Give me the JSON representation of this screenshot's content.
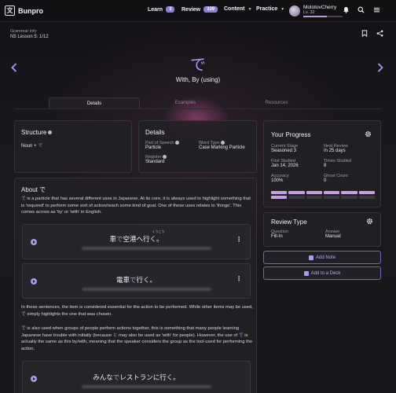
{
  "app": {
    "logo_glyph": "文",
    "name": "Bunpro"
  },
  "nav": {
    "learn_label": "Learn",
    "learn_count": "3",
    "review_label": "Review",
    "review_count": "339",
    "content_label": "Content",
    "practice_label": "Practice"
  },
  "user": {
    "name": "MolotovCherry",
    "level": "Lv. 32",
    "xp_fraction": 0.6
  },
  "header": {
    "section": "Grammar info",
    "lesson": "N5 Lesson 5: 1/12",
    "grammar": "で",
    "meaning": "With, By (using)"
  },
  "tabs": [
    "Details",
    "Examples",
    "Resources"
  ],
  "structure": {
    "title": "Structure",
    "formula_prefix": "Noun + ",
    "formula_particle": "で"
  },
  "details": {
    "title": "Details",
    "pos_label": "Part of Speech",
    "pos_value": "Particle",
    "word_type_label": "Word Type",
    "word_type_value": "Case Marking Particle",
    "register_label": "Register",
    "register_value": "Standard"
  },
  "about": {
    "title_prefix": "About ",
    "title_particle": "で",
    "p1_particle": "で",
    "p1": " is a particle that has several different uses in Japanese. At its core, it is always used to highlight something that is 'required' to perform some sort of action/reach some kind of goal. One of these uses relates to 'things'. This comes across as 'by' or 'with' in English.",
    "p2_a": "In these sentences, the item is considered essential for the action to be performed. While other items may be used, ",
    "p2_particle": "で",
    "p2_b": " simply highlights the one that was chosen.",
    "p3_particle_1": "で",
    "p3_a": " is also used when groups of people perform actions together, this is something that many people learning Japanese have trouble with initially (because ",
    "p3_particle_2": "と",
    "p3_b": " may also be used as 'with' for people). However, the use of ",
    "p3_particle_3": "で",
    "p3_c": " is actually the same as this by/with, meaning that the speaker considers the group as the tool used for performing the action.",
    "examples": [
      {
        "furigana": "くうこう",
        "before": "車",
        "particle": "で",
        "after": "空港へ行く。"
      },
      {
        "furigana": "",
        "before": "電車",
        "particle": "で",
        "after": "行く。"
      },
      {
        "furigana": "",
        "before": "みんな",
        "particle": "で",
        "after": "レストランに行く。"
      }
    ]
  },
  "progress": {
    "title": "Your Progress",
    "current_stage_label": "Current Stage",
    "current_stage_value": "Seasoned 3",
    "next_review_label": "Next Review",
    "next_review_value": "In 25 days",
    "first_studied_label": "First Studied",
    "first_studied_value": "Jan 14, 2026",
    "times_studied_label": "Times Studied",
    "times_studied_value": "8",
    "accuracy_label": "Accuracy",
    "accuracy_value": "100%",
    "ghost_count_label": "Ghost Count",
    "ghost_count_value": "0",
    "segments_filled": 7,
    "segments_total": 12
  },
  "review_type": {
    "title": "Review Type",
    "question_label": "Question",
    "question_value": "Fill-In",
    "answer_label": "Answer",
    "answer_value": "Manual"
  },
  "actions": {
    "add_note": "Add Note",
    "add_to_deck": "Add to a Deck"
  },
  "colors": {
    "accent": "#a99bf0",
    "progress_fill": "#c7a0e0",
    "badge": "#8b7fd8"
  }
}
